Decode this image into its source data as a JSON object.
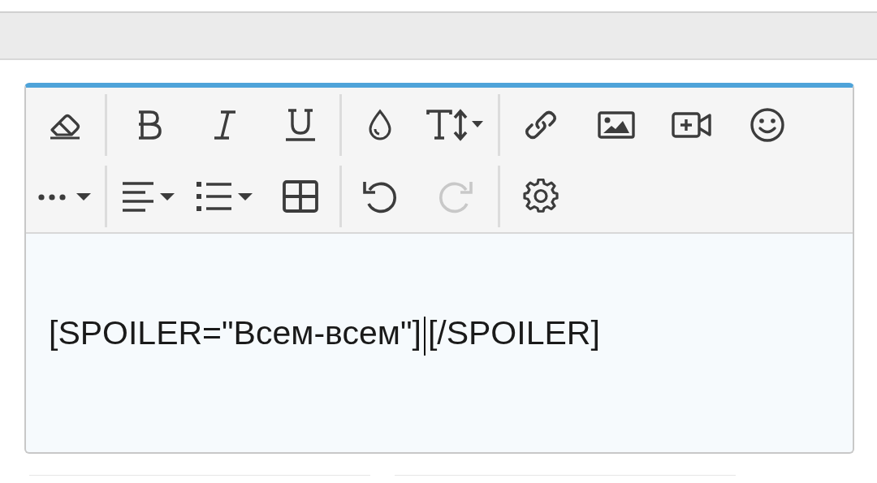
{
  "toolbar": {
    "rows": [
      [
        [
          {
            "kind": "eraser",
            "disabled": false
          }
        ],
        [
          {
            "kind": "bold",
            "disabled": false
          },
          {
            "kind": "italic",
            "disabled": false
          },
          {
            "kind": "underline",
            "disabled": false
          }
        ],
        [
          {
            "kind": "color",
            "disabled": false
          },
          {
            "kind": "font-size",
            "disabled": false
          }
        ],
        [
          {
            "kind": "link",
            "disabled": false
          },
          {
            "kind": "image",
            "disabled": false
          },
          {
            "kind": "video",
            "disabled": false
          },
          {
            "kind": "smiley",
            "disabled": false
          }
        ]
      ],
      [
        [
          {
            "kind": "more",
            "disabled": false
          }
        ],
        [
          {
            "kind": "align",
            "disabled": false
          },
          {
            "kind": "list",
            "disabled": false
          },
          {
            "kind": "table",
            "disabled": false
          }
        ],
        [
          {
            "kind": "undo",
            "disabled": false
          },
          {
            "kind": "redo",
            "disabled": true
          }
        ],
        [
          {
            "kind": "settings",
            "disabled": false
          }
        ]
      ]
    ]
  },
  "editor": {
    "text_before_caret": "[SPOILER=\"Всем-всем\"]",
    "text_after_caret": "[/SPOILER]"
  }
}
